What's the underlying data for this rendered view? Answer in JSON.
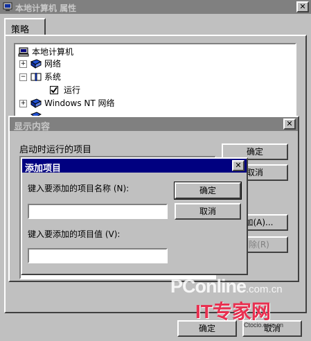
{
  "main_window": {
    "title": "本地计算机 属性",
    "tab": "策略",
    "ok_label": "确定",
    "cancel_label": "取消"
  },
  "tree": {
    "items": [
      {
        "label": "本地计算机",
        "icon": "computer-icon"
      },
      {
        "label": "网络",
        "icon": "book-icon"
      },
      {
        "label": "系统",
        "icon": "open-book-icon"
      },
      {
        "label": "运行",
        "icon": "checkbox-checked-icon"
      },
      {
        "label": "Windows NT 网络",
        "icon": "book-icon"
      }
    ]
  },
  "show_contents": {
    "title": "显示内容",
    "list_label": "启动时运行的项目",
    "ok_label": "确定",
    "cancel_label": "取消",
    "add_label": "添加(A)...",
    "remove_label": "删除(R)"
  },
  "add_item": {
    "title": "添加项目",
    "name_label": "键入要添加的项目名称 (N):",
    "value_label": "键入要添加的项目值 (V):",
    "name_value": "",
    "value_value": "",
    "ok_label": "确定",
    "cancel_label": "取消"
  },
  "watermark": {
    "pconline": "PConline",
    "dotcom": ".com.cn",
    "it_logo": "IT专家网",
    "ctocio": "Ctocio.com.cn"
  }
}
